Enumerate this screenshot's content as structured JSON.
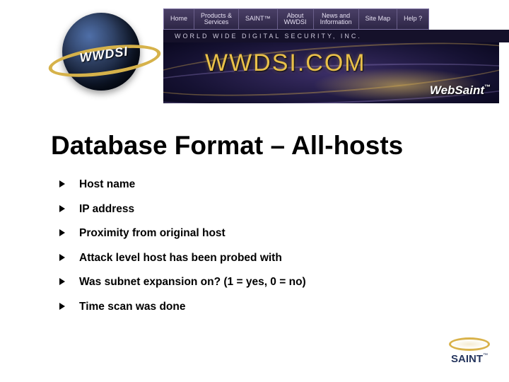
{
  "banner": {
    "globe_acronym": "WWDSI",
    "tagline": "WORLD WIDE DIGITAL SECURITY, INC.",
    "domain_label": "WWDSI.COM",
    "product_label": "WebSaint",
    "tm": "™",
    "nav": [
      "Home",
      "Products &\nServices",
      "SAINT™",
      "About\nWWDSI",
      "News and\nInformation",
      "Site Map",
      "Help ?"
    ]
  },
  "title": "Database Format – All-hosts",
  "bullets": [
    "Host name",
    "IP address",
    "Proximity from original host",
    "Attack level host has been probed with",
    "Was subnet expansion on? (1 = yes, 0 = no)",
    "Time scan was done"
  ],
  "footer_logo": {
    "text": "SAINT",
    "tm": "™"
  }
}
